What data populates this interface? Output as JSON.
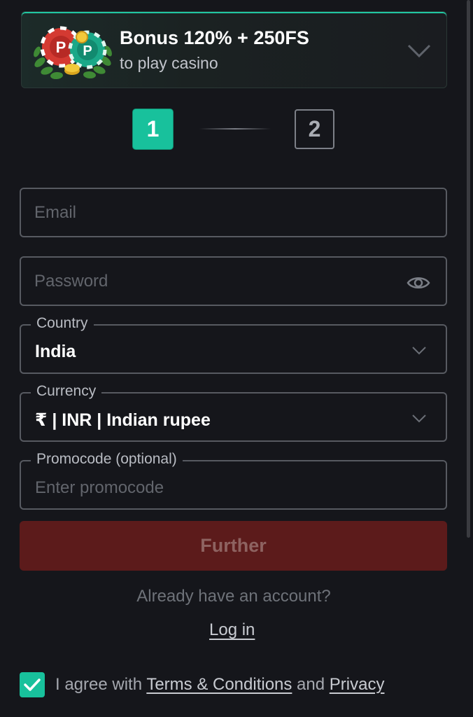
{
  "bonus": {
    "title": "Bonus 120% + 250FS",
    "subtitle": "to play casino",
    "art_icon": "casino-chips-icon",
    "toggle_icon": "chevron-down-icon"
  },
  "steps": {
    "step1": "1",
    "step2": "2",
    "active": "1"
  },
  "form": {
    "email": {
      "placeholder": "Email",
      "value": ""
    },
    "password": {
      "placeholder": "Password",
      "value": "",
      "toggle_icon": "eye-icon"
    },
    "country": {
      "label": "Country",
      "value": "India"
    },
    "currency": {
      "label": "Currency",
      "value": "₹ | INR | Indian rupee"
    },
    "promocode": {
      "label": "Promocode (optional)",
      "placeholder": "Enter promocode"
    }
  },
  "actions": {
    "further_label": "Further",
    "already_text": "Already have an account?",
    "login_label": "Log in"
  },
  "agreement": {
    "checked": true,
    "prefix": "I agree with ",
    "terms_label": "Terms & Conditions",
    "middle": " and ",
    "privacy_label": "Privacy"
  },
  "colors": {
    "background": "#15161b",
    "accent": "#18c19c",
    "button_disabled": "#5c1b1b",
    "field_border": "#575a61"
  }
}
